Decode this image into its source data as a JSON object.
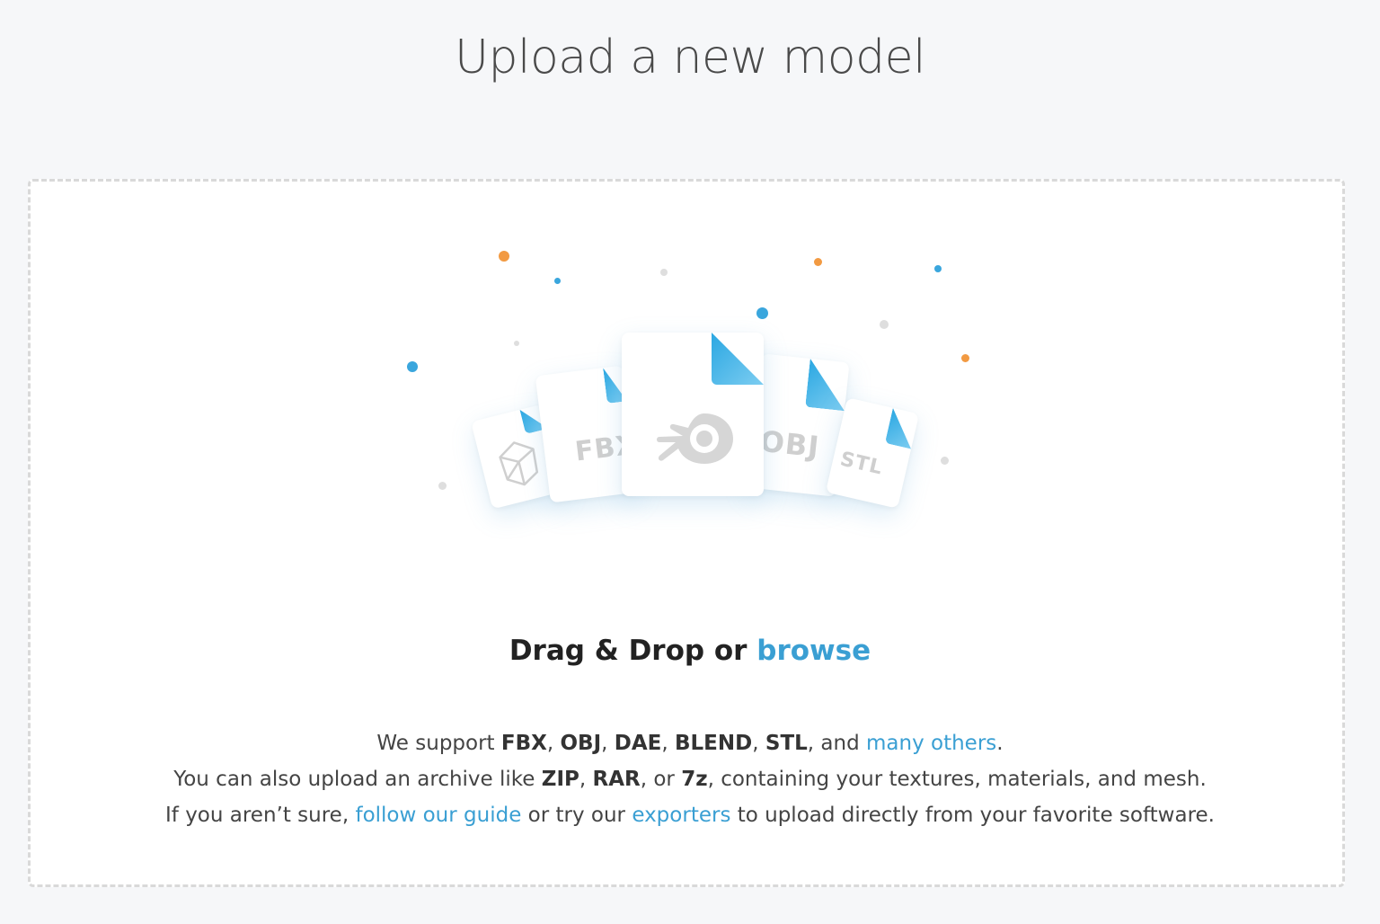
{
  "page": {
    "title": "Upload a new model"
  },
  "dropzone": {
    "drag_text": "Drag & Drop or",
    "browse_link": "browse"
  },
  "illustration": {
    "cards": [
      {
        "icon": "sketchfab-logo-icon",
        "label": ""
      },
      {
        "icon": "file-icon",
        "label": "FBX"
      },
      {
        "icon": "blender-logo-icon",
        "label": ""
      },
      {
        "icon": "file-icon",
        "label": "OBJ"
      },
      {
        "icon": "file-icon",
        "label": "STL"
      }
    ],
    "colors": {
      "accent": "#3aa6dd",
      "orange": "#f29a42",
      "grey": "#dedede"
    }
  },
  "info": {
    "line1": {
      "prefix": "We support",
      "formats": [
        "FBX",
        "OBJ",
        "DAE",
        "BLEND",
        "STL"
      ],
      "sep": ",",
      "and_text": ", and",
      "link": "many others",
      "suffix": "."
    },
    "line2": {
      "prefix": "You can also upload an archive like",
      "archives": [
        "ZIP",
        "RAR",
        "7z"
      ],
      "sep": ",",
      "or_text": ", or",
      "suffix": ", containing your textures, materials, and mesh."
    },
    "line3": {
      "prefix": "If you aren’t sure,",
      "guide_link": "follow our guide",
      "middle": "or try our",
      "exporters_link": "exporters",
      "suffix": "to upload directly from your favorite software."
    }
  }
}
